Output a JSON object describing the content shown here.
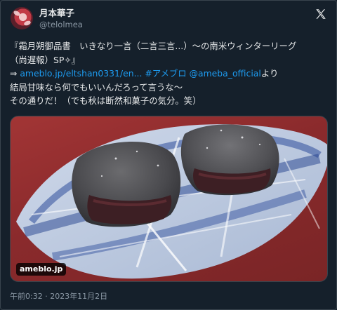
{
  "author": {
    "display_name": "月本華子",
    "handle": "@telolmea"
  },
  "tweet": {
    "line1": "『霜月朔御品書　いきなり一言（二言三言...）～の南米ウィンターリーグ",
    "line2": "（尚遅報）SP✧』",
    "line3_prefix": "⇒ ",
    "line3_link": "ameblo.jp/eltshan0331/en...",
    "line3_hashtag": "#アメブロ",
    "line3_mention": "@ameba_official",
    "line3_suffix": "より",
    "line4": "結局甘味なら何でもいいんだろって言うな～",
    "line5": "その通りだ！（でも秋は断然和菓子の気分。笑）"
  },
  "media": {
    "badge": "ameblo.jp"
  },
  "timestamp": "午前0:32 · 2023年11月2日",
  "colors": {
    "background": "#15202b",
    "text": "#e7e9ea",
    "secondary": "#8b98a5",
    "link": "#1d9bf0"
  },
  "icons": {
    "logo": "x-logo-icon"
  }
}
